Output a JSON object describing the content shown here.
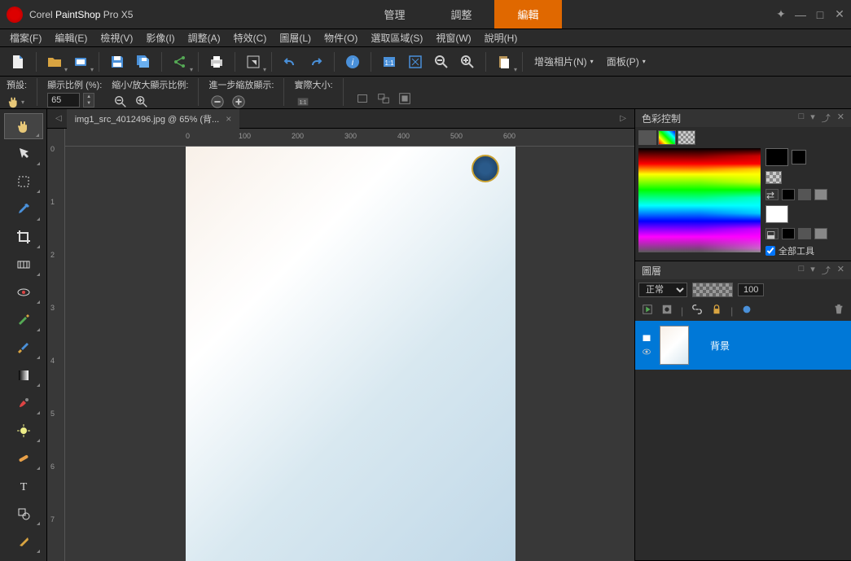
{
  "app": {
    "brand": "Corel",
    "name": "PaintShop",
    "edition": "Pro X5"
  },
  "topTabs": [
    {
      "label": "管理",
      "active": false
    },
    {
      "label": "調整",
      "active": false
    },
    {
      "label": "編輯",
      "active": true
    }
  ],
  "menu": [
    {
      "label": "檔案(F)"
    },
    {
      "label": "編輯(E)"
    },
    {
      "label": "檢視(V)"
    },
    {
      "label": "影像(I)"
    },
    {
      "label": "調整(A)"
    },
    {
      "label": "特效(C)"
    },
    {
      "label": "圖層(L)"
    },
    {
      "label": "物件(O)"
    },
    {
      "label": "選取區域(S)"
    },
    {
      "label": "視窗(W)"
    },
    {
      "label": "說明(H)"
    }
  ],
  "toolbar": {
    "enhancePhoto": "增強相片(N)",
    "panels": "面板(P)"
  },
  "optbar": {
    "preset": "預設:",
    "zoomLabel": "顯示比例 (%):",
    "zoomValue": "65",
    "fitLabel": "縮小/放大顯示比例:",
    "stepLabel": "進一步縮放顯示:",
    "actualLabel": "實際大小:"
  },
  "document": {
    "tab": "img1_src_4012496.jpg @ 65% (背...",
    "rulerH": [
      "0",
      "100",
      "200",
      "300",
      "400",
      "500",
      "600"
    ],
    "rulerV": [
      "0",
      "1",
      "2",
      "3",
      "4",
      "5",
      "6",
      "7"
    ]
  },
  "panels": {
    "color": {
      "title": "色彩控制",
      "allTools": "全部工具"
    },
    "layers": {
      "title": "圖層",
      "blendMode": "正常",
      "opacity": "100",
      "items": [
        {
          "name": "背景"
        }
      ]
    }
  }
}
